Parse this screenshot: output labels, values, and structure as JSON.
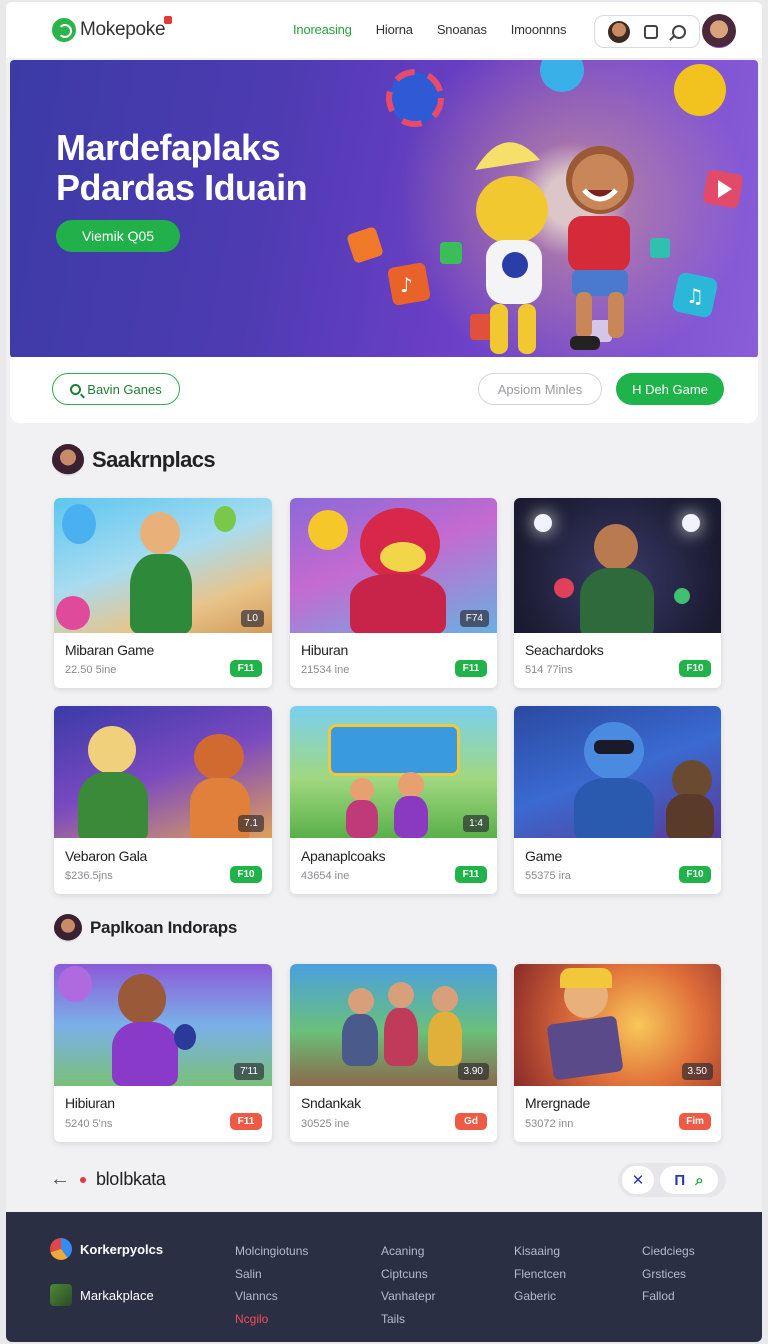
{
  "header": {
    "logo_text": "Mokepoke",
    "nav": [
      "Inoreasing",
      "Hiorna",
      "Snoanas",
      "Imoonnns"
    ]
  },
  "hero": {
    "title_line1": "Mardefaplaks",
    "title_line2": "Pdardas Iduain",
    "cta_label": "Viemik  Q05"
  },
  "actions": {
    "search_label": "Bavin Ganes",
    "secondary_label": "Apsiom Minles",
    "primary_label": "H Deh Game"
  },
  "section1": {
    "title": "Saakrnplacs",
    "cards": [
      {
        "title": "Mibaran Game",
        "meta": "22.50 5ine",
        "badge": "L0",
        "pill": "F11"
      },
      {
        "title": "Hiburan",
        "meta": "21534 ine",
        "badge": "F74",
        "pill": "F11"
      },
      {
        "title": "Seachardoks",
        "meta": "514 77ins",
        "badge": "",
        "pill": "F10"
      },
      {
        "title": "Vebaron Gala",
        "meta": "$236.5jns",
        "badge": "7.1",
        "pill": "F10"
      },
      {
        "title": "Apanaplcoaks",
        "meta": "43654 ine",
        "badge": "1:4",
        "pill": "F11"
      },
      {
        "title": "Game",
        "meta": "55375 ira",
        "badge": "",
        "pill": "F10"
      }
    ]
  },
  "section2": {
    "title": "Paplkoan Indoraps",
    "cards": [
      {
        "title": "Hibiuran",
        "meta": "5240 5'ns",
        "badge": "7'11",
        "pill": "F11"
      },
      {
        "title": "Sndankak",
        "meta": "30525 ine",
        "badge": "3.90",
        "pill": "Gd"
      },
      {
        "title": "Mrergnade",
        "meta": "53072 inn",
        "badge": "3.50",
        "pill": "Fim"
      }
    ]
  },
  "bottom": {
    "label": "bloIbkata",
    "pager_icons": [
      "close-icon",
      "bookmark-icon",
      "search-icon"
    ],
    "pager_glyphs": [
      "✕",
      "Π",
      "⌕"
    ]
  },
  "footer": {
    "brand1": "Korkerpyolcs",
    "brand2": "Markakplace",
    "col1": [
      "Molcingiotuns",
      "Salin",
      "Vlanncs"
    ],
    "col1_highlight": "Ncgilo",
    "col2": [
      "Acaning",
      "Ciptcuns",
      "Vanhatepr",
      "Tails"
    ],
    "col3": [
      "Kisaaing",
      "Flenctcen",
      "Gaberic"
    ],
    "col4": [
      "Ciedciegs",
      "Grstices",
      "Fallod"
    ]
  },
  "colors": {
    "accent_green": "#20b34a",
    "hero_purple": "#4e3bb2",
    "footer_bg": "#2b2f44",
    "pill_red": "#ef5a46"
  }
}
